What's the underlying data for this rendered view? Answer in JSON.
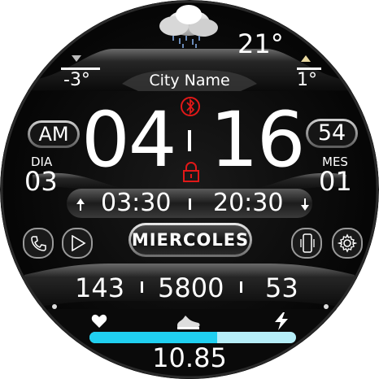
{
  "weather": {
    "icon": "cloud-rain-icon",
    "current_temp": "21°",
    "min_temp": "-3°",
    "max_temp": "1°",
    "city": "City Name"
  },
  "time": {
    "ampm": "AM",
    "hours": "04",
    "minutes": "16",
    "seconds": "54"
  },
  "date": {
    "day_label": "DIA",
    "day": "03",
    "month_label": "MES",
    "month": "01",
    "weekday": "MIERCOLES"
  },
  "sun": {
    "sunrise": "03:30",
    "sunset": "20:30"
  },
  "stats": {
    "heart_rate": "143",
    "steps": "5800",
    "battery": "53",
    "distance": "10.85",
    "progress": 0.62
  },
  "status": {
    "bluetooth_icon": "bluetooth-icon",
    "lock_icon": "lock-icon"
  },
  "colors": {
    "accent_red": "#e01818",
    "progress_fill": "#20d0f0",
    "progress_track": "#b6eef8"
  }
}
